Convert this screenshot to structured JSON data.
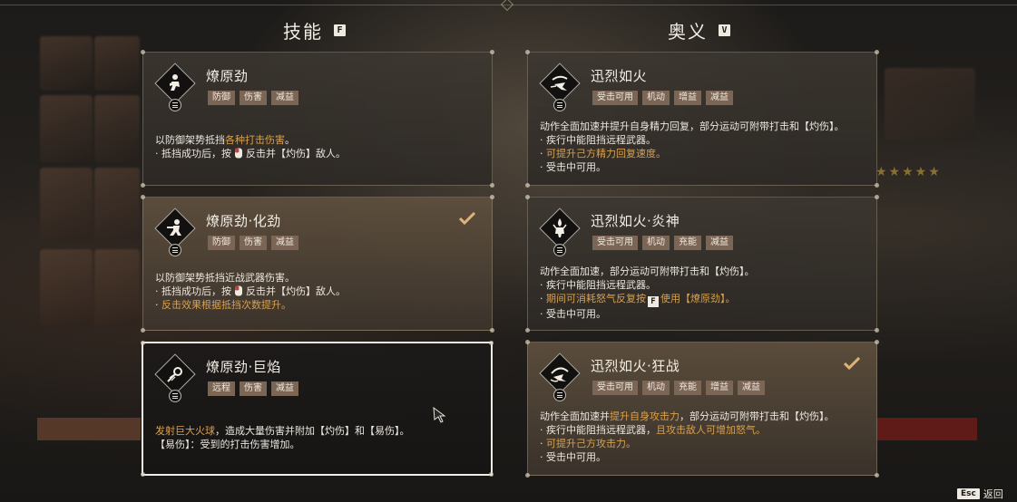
{
  "skills_header": {
    "title": "技能",
    "key": "F"
  },
  "ougi_header": {
    "title": "奥义",
    "key": "V"
  },
  "skills": [
    {
      "title": "燎原劲",
      "tags": [
        "防御",
        "伤害",
        "减益"
      ],
      "equipped": false,
      "lines": [
        [
          {
            "t": "以防御架势抵挡"
          },
          {
            "t": "各种打击伤害",
            "hl": true
          },
          {
            "t": "。"
          }
        ],
        [
          {
            "t": "· 抵挡成功后，按"
          },
          {
            "key": "mouse"
          },
          {
            "t": "反击并【灼伤】敌人。"
          }
        ]
      ]
    },
    {
      "title": "燎原劲·化劲",
      "tags": [
        "防御",
        "伤害",
        "减益"
      ],
      "equipped": true,
      "lines": [
        [
          {
            "t": "以防御架势抵挡近战武器伤害。"
          }
        ],
        [
          {
            "t": "· 抵挡成功后，按"
          },
          {
            "key": "mouse"
          },
          {
            "t": "反击并【灼伤】敌人。"
          }
        ],
        [
          {
            "t": "· "
          },
          {
            "t": "反击效果根据抵挡次数提升。",
            "hl": true
          }
        ]
      ]
    },
    {
      "title": "燎原劲·巨焰",
      "tags": [
        "远程",
        "伤害",
        "减益"
      ],
      "equipped": false,
      "lines": [
        [
          {
            "t": "发射巨大火球",
            "hl": true
          },
          {
            "t": "，造成大量伤害并附加【灼伤】和【易伤】。"
          }
        ],
        [
          {
            "t": "【易伤】：受到的打击伤害增加。"
          }
        ]
      ]
    }
  ],
  "ougi": [
    {
      "title": "迅烈如火",
      "tags": [
        "受击可用",
        "机动",
        "增益",
        "减益"
      ],
      "equipped": false,
      "lines": [
        [
          {
            "t": "动作全面加速并提升自身精力回复，部分运动可附带打击和【灼伤】。"
          }
        ],
        [
          {
            "t": "· 疾行中能阻挡远程武器。"
          }
        ],
        [
          {
            "t": "· "
          },
          {
            "t": "可提升己方精力回复速度。",
            "hl": true
          }
        ],
        [
          {
            "t": "· 受击中可用。"
          }
        ]
      ]
    },
    {
      "title": "迅烈如火·炎神",
      "tags": [
        "受击可用",
        "机动",
        "充能",
        "减益"
      ],
      "equipped": false,
      "lines": [
        [
          {
            "t": "动作全面加速，部分运动可附带打击和【灼伤】。"
          }
        ],
        [
          {
            "t": "· 疾行中能阻挡远程武器。"
          }
        ],
        [
          {
            "t": "· "
          },
          {
            "t": "期间可消耗怒气反复按",
            "hl": true
          },
          {
            "key": "F"
          },
          {
            "t": "使用【燎原劲】。",
            "hl": true
          }
        ],
        [
          {
            "t": "· 受击中可用。"
          }
        ]
      ]
    },
    {
      "title": "迅烈如火·狂战",
      "tags": [
        "受击可用",
        "机动",
        "充能",
        "增益",
        "减益"
      ],
      "equipped": true,
      "lines": [
        [
          {
            "t": "动作全面加速并"
          },
          {
            "t": "提升自身攻击力",
            "hl": true
          },
          {
            "t": "，部分运动可附带打击和【灼伤】。"
          }
        ],
        [
          {
            "t": "· 疾行中能阻挡远程武器，"
          },
          {
            "t": "且攻击敌人可增加怒气。",
            "hl": true
          }
        ],
        [
          {
            "t": "· "
          },
          {
            "t": "可提升己方攻击力。",
            "hl": true
          }
        ],
        [
          {
            "t": "· 受击中可用。"
          }
        ]
      ]
    }
  ],
  "footer": {
    "key": "Esc",
    "label": "返回"
  },
  "colors": {
    "highlight": "#d9a04e",
    "tag_bg": "#7b6555",
    "check": "#e0b27a"
  },
  "icons": [
    "guard-stance-icon",
    "parry-stance-icon",
    "fireball-icon",
    "blazing-speed-icon",
    "fire-god-icon",
    "berserk-icon",
    "menu-icon",
    "checkmark-icon",
    "mouse-button-icon"
  ]
}
